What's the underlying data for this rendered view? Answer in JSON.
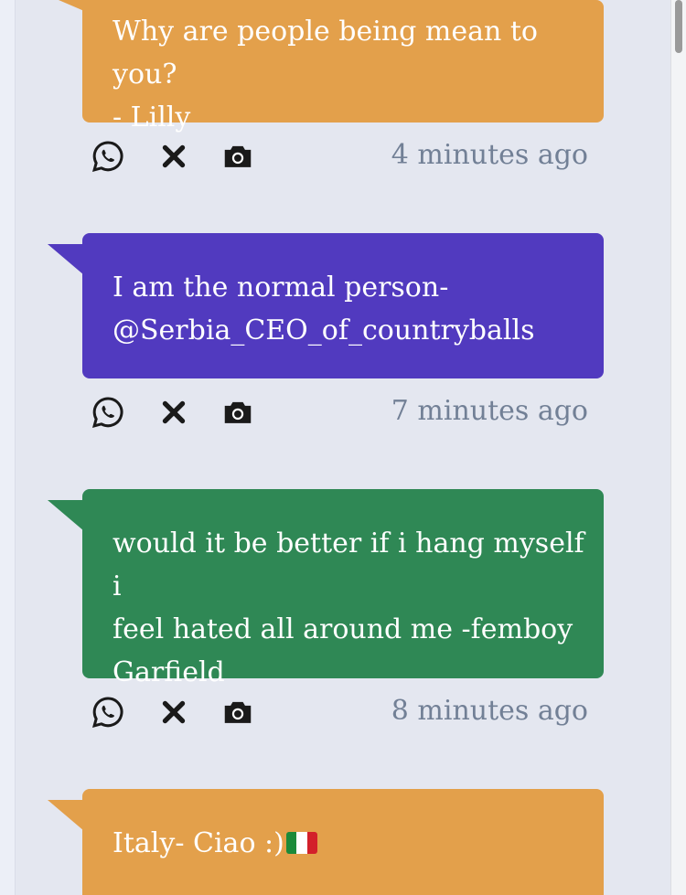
{
  "colors": {
    "orange": "#e3a04b",
    "purple": "#513abf",
    "green": "#2f8855",
    "time": "#728096",
    "icon": "#1a1a1a"
  },
  "messages": [
    {
      "lines": [
        "Why are people being mean to you?",
        "- Lilly"
      ],
      "time": "4 minutes ago",
      "color": "orange"
    },
    {
      "lines": [
        "I am the normal person-",
        "@Serbia_CEO_of_countryballs"
      ],
      "time": "7 minutes ago",
      "color": "purple"
    },
    {
      "lines": [
        "would it be better if i hang myself i",
        "feel hated all around me -femboy",
        "Garfield"
      ],
      "time": "8 minutes ago",
      "color": "green"
    },
    {
      "lines": [
        "Italy- Ciao :)"
      ],
      "time": "",
      "color": "orange",
      "emoji": "italy-flag"
    }
  ],
  "actions": {
    "share_icon": "whatsapp-icon",
    "delete_icon": "close-icon",
    "screenshot_icon": "camera-icon"
  }
}
